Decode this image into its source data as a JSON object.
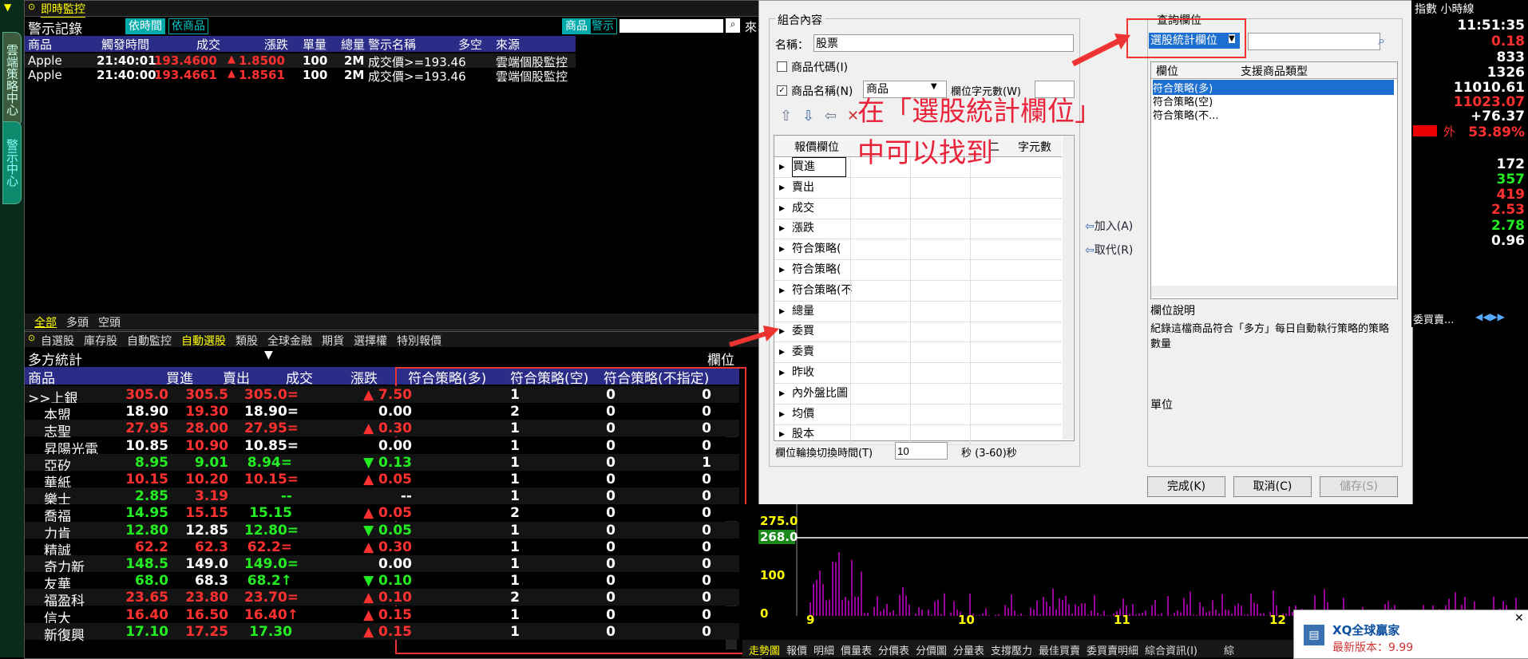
{
  "sidebar": {
    "tab1": "雲端策略中心",
    "tab2": "警示中心"
  },
  "monitor": {
    "window_title": "即時監控",
    "section_title": "警示記錄",
    "btn_by_time": "依時間",
    "btn_by_product": "依商品",
    "btn_product": "商品",
    "btn_alert": "警示",
    "search_placeholder": "",
    "trailing": "來",
    "columns": [
      "商品",
      "觸發時間",
      "成交",
      "漲跌",
      "單量",
      "總量",
      "警示名稱",
      "多空",
      "來源"
    ],
    "rows": [
      {
        "product": "Apple",
        "time": "21:40:01",
        "price": "193.4600",
        "chg": "1.8500",
        "qty": "100",
        "vol": "2M",
        "alert": "成交價>=193.46",
        "side": "",
        "source": "雲端個股監控"
      },
      {
        "product": "Apple",
        "time": "21:40:00",
        "price": "193.4661",
        "chg": "1.8561",
        "qty": "100",
        "vol": "2M",
        "alert": "成交價>=193.46",
        "side": "",
        "source": "雲端個股監控"
      }
    ],
    "bottom_tabs": [
      "全部",
      "多頭",
      "空頭"
    ]
  },
  "watch": {
    "tabs": [
      "自選股",
      "庫存股",
      "自動監控",
      "自動選股",
      "類股",
      "全球金融",
      "期貨",
      "選擇權",
      "特別報價"
    ],
    "active_tab": "自動選股",
    "list_title": "多方統計",
    "column_label": "欄位",
    "columns": [
      "商品",
      "買進",
      "賣出",
      "成交",
      "漲跌",
      "符合策略(多)",
      "符合策略(空)",
      "符合策略(不指定)"
    ],
    "rows": [
      {
        "name": ">>上銀",
        "bid": "305.0",
        "ask": "305.5",
        "last": "305.0=",
        "chg": "▲ 7.50",
        "c1": "1",
        "c2": "0",
        "c3": "0",
        "color": "#ff3030",
        "chgColor": "#ff3030"
      },
      {
        "name": "本盟",
        "bid": "18.90",
        "ask": "19.30",
        "last": "18.90=",
        "chg": "0.00",
        "c1": "2",
        "c2": "0",
        "c3": "0",
        "color": "#ffffff",
        "chgColor": "#ffffff",
        "askColor": "#ff3030"
      },
      {
        "name": "志聖",
        "bid": "27.95",
        "ask": "28.00",
        "last": "27.95=",
        "chg": "▲ 0.30",
        "c1": "1",
        "c2": "0",
        "c3": "0",
        "color": "#ff3030",
        "chgColor": "#ff3030"
      },
      {
        "name": "昇陽光電",
        "bid": "10.85",
        "ask": "10.90",
        "last": "10.85=",
        "chg": "0.00",
        "c1": "1",
        "c2": "0",
        "c3": "0",
        "color": "#ffffff",
        "chgColor": "#ffffff",
        "askColor": "#ff3030"
      },
      {
        "name": "亞矽",
        "bid": "8.95",
        "ask": "9.01",
        "last": "8.94=",
        "chg": "▼ 0.13",
        "c1": "1",
        "c2": "0",
        "c3": "1",
        "color": "#22ee22",
        "chgColor": "#22ee22"
      },
      {
        "name": "華紙",
        "bid": "10.15",
        "ask": "10.20",
        "last": "10.15=",
        "chg": "▲ 0.05",
        "c1": "1",
        "c2": "0",
        "c3": "0",
        "color": "#ff3030",
        "chgColor": "#ff3030"
      },
      {
        "name": "樂士",
        "bid": "2.85",
        "ask": "3.19",
        "last": "--",
        "chg": "--",
        "c1": "1",
        "c2": "0",
        "c3": "0",
        "color": "#22ee22",
        "chgColor": "#ffffff",
        "askColor": "#ff3030"
      },
      {
        "name": "喬福",
        "bid": "14.95",
        "ask": "15.15",
        "last": "15.15",
        "chg": "▲ 0.05",
        "c1": "2",
        "c2": "0",
        "c3": "0",
        "color": "#22ee22",
        "chgColor": "#ff3030",
        "askColor": "#ff3030"
      },
      {
        "name": "力肯",
        "bid": "12.80",
        "ask": "12.85",
        "last": "12.80=",
        "chg": "▼ 0.05",
        "c1": "1",
        "c2": "0",
        "c3": "0",
        "color": "#22ee22",
        "chgColor": "#22ee22",
        "askColor": "#ffffff"
      },
      {
        "name": "精誠",
        "bid": "62.2",
        "ask": "62.3",
        "last": "62.2=",
        "chg": "▲ 0.30",
        "c1": "1",
        "c2": "0",
        "c3": "0",
        "color": "#ff3030",
        "chgColor": "#ff3030"
      },
      {
        "name": "奇力新",
        "bid": "148.5",
        "ask": "149.0",
        "last": "149.0=",
        "chg": "0.00",
        "c1": "1",
        "c2": "0",
        "c3": "0",
        "color": "#22ee22",
        "chgColor": "#ffffff",
        "askColor": "#ffffff"
      },
      {
        "name": "友華",
        "bid": "68.0",
        "ask": "68.3",
        "last": "68.2↑",
        "chg": "▼ 0.10",
        "c1": "1",
        "c2": "0",
        "c3": "0",
        "color": "#22ee22",
        "chgColor": "#22ee22",
        "askColor": "#ffffff"
      },
      {
        "name": "福盈科",
        "bid": "23.65",
        "ask": "23.80",
        "last": "23.70=",
        "chg": "▲ 0.10",
        "c1": "2",
        "c2": "0",
        "c3": "0",
        "color": "#ff3030",
        "chgColor": "#ff3030"
      },
      {
        "name": "信大",
        "bid": "16.40",
        "ask": "16.50",
        "last": "16.40↑",
        "chg": "▲ 0.15",
        "c1": "1",
        "c2": "0",
        "c3": "0",
        "color": "#ff3030",
        "chgColor": "#ff3030"
      },
      {
        "name": "新復興",
        "bid": "17.10",
        "ask": "17.25",
        "last": "17.30",
        "chg": "▲ 0.15",
        "c1": "1",
        "c2": "0",
        "c3": "0",
        "color": "#22ee22",
        "chgColor": "#ff3030",
        "askColor": "#ff3030"
      }
    ]
  },
  "dialog": {
    "group_title": "組合內容",
    "name_label": "名稱：",
    "name_value": "股票",
    "chk_code": "商品代碼(I)",
    "chk_name": "商品名稱(N)",
    "name_select": "商品",
    "width_label": "欄位字元數(W)",
    "col_header": "報價欄位",
    "col_extra": "二",
    "col_chars": "字元數",
    "fields": [
      "買進",
      "賣出",
      "成交",
      "漲跌",
      "符合策略(",
      "符合策略(",
      "符合策略(不",
      "總量",
      "委買",
      "委賣",
      "昨收",
      "內外盤比圖",
      "均價",
      "股本"
    ],
    "switch_label": "欄位輪換切換時間(T)",
    "switch_value": "10",
    "switch_unit": "秒  (3-60)秒",
    "add_button": "加入(A)",
    "replace_button": "取代(R)",
    "query_title": "查詢欄位",
    "query_select": "選股統計欄位",
    "q_col1": "欄位",
    "q_col2": "支援商品類型",
    "q_items": [
      "符合策略(多)",
      "符合策略(空)",
      "符合策略(不..."
    ],
    "desc_title": "欄位說明",
    "desc_text": "紀錄這檔商品符合「多方」每日自動執行策略的策略數量",
    "unit_title": "單位",
    "ok_button": "完成(K)",
    "cancel_button": "取消(C)",
    "save_button": "儲存(S)"
  },
  "annotation": {
    "line1": "在「選股統計欄位」",
    "line2": "中可以找到"
  },
  "right": {
    "header": "指數 小時線",
    "values": [
      "11:51:35",
      "0.18",
      "833",
      "1326",
      "11010.61",
      "11023.07",
      "+76.37",
      "53.89%",
      "172",
      "357",
      "419",
      "2.53",
      "2.78",
      "0.96"
    ],
    "colors": [
      "#ffffff",
      "#ff3030",
      "#ffffff",
      "#ffffff",
      "#ffffff",
      "#ff3030",
      "#ffffff",
      "#ff3030",
      "#ffffff",
      "#22ee22",
      "#ff3030",
      "#ff3030",
      "#22ee22",
      "#ffffff"
    ],
    "outer_label": "外",
    "order_label": "委買賣..."
  },
  "chart": {
    "y_labels": [
      "275.0",
      "268.0",
      "100",
      "0"
    ],
    "x_labels": [
      "9",
      "10",
      "11",
      "12"
    ],
    "bottom_tabs": [
      "走勢圖",
      "報價",
      "明細",
      "價量表",
      "分價表",
      "分價圖",
      "分量表",
      "支撐壓力",
      "最佳買賣",
      "委買賣明細",
      "綜合資訊(I)",
      "綜"
    ]
  },
  "toast": {
    "title": "XQ全球贏家",
    "version_label": "最新版本：",
    "version": "9.99"
  }
}
